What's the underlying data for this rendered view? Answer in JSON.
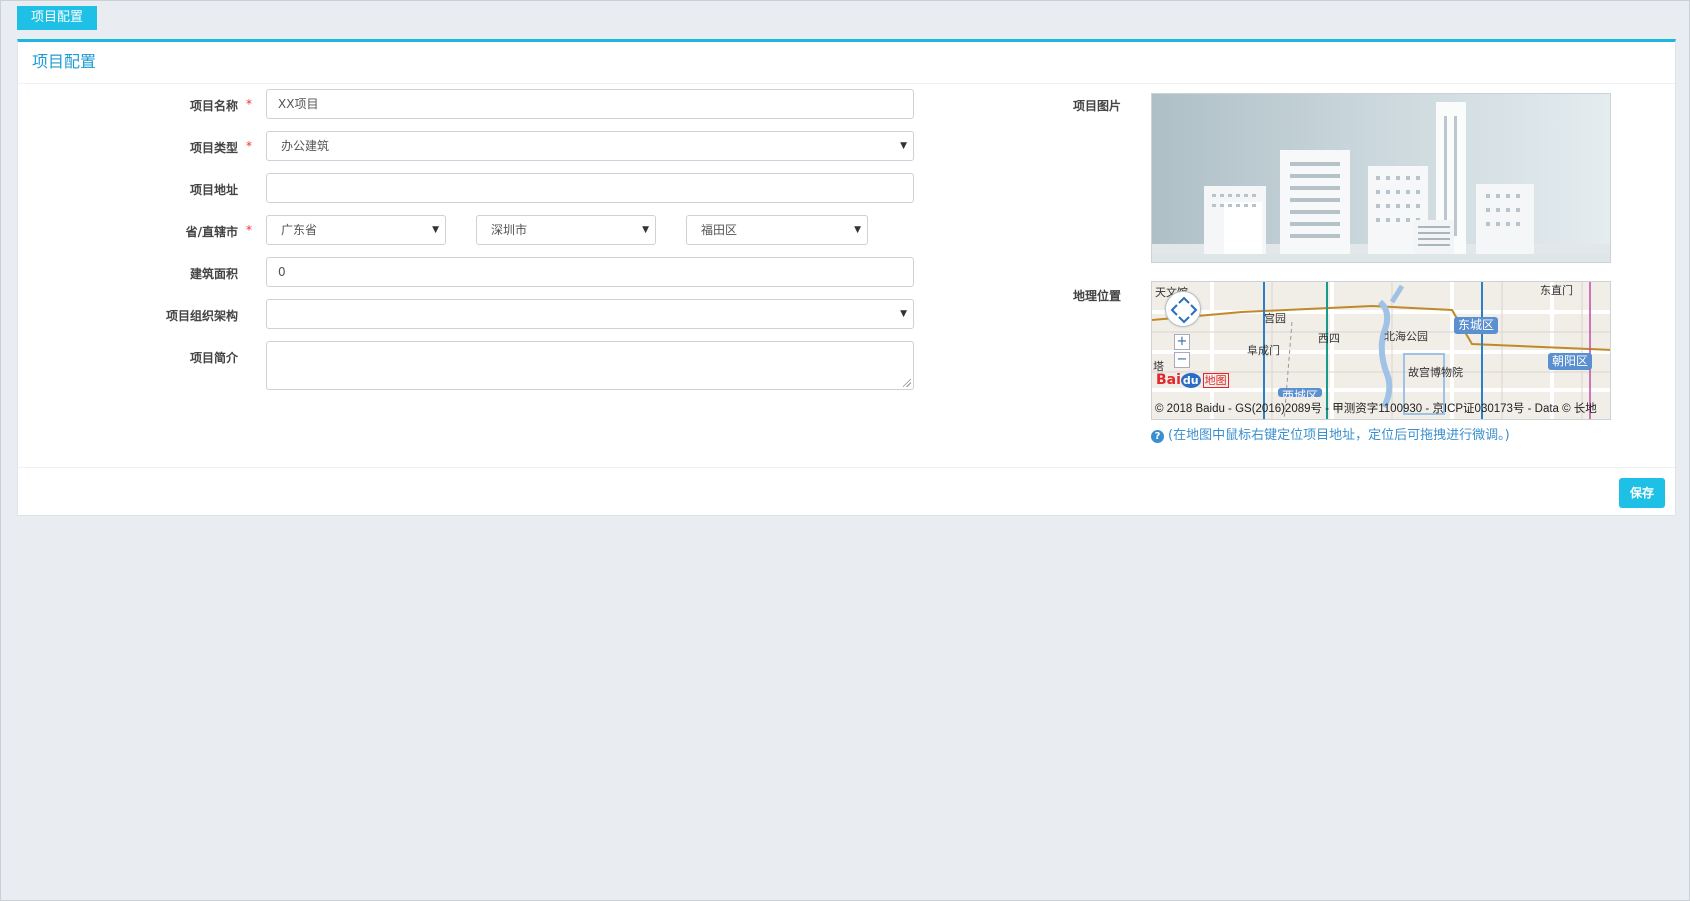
{
  "tab": {
    "label": "项目配置"
  },
  "panel": {
    "title": "项目配置"
  },
  "form": {
    "name": {
      "label": "项目名称",
      "required": "*",
      "value": "XX项目"
    },
    "type": {
      "label": "项目类型",
      "required": "*",
      "value": "办公建筑"
    },
    "address": {
      "label": "项目地址",
      "value": ""
    },
    "region": {
      "label": "省/直辖市",
      "required": "*",
      "province": "广东省",
      "city": "深圳市",
      "district": "福田区"
    },
    "area": {
      "label": "建筑面积",
      "value": "0"
    },
    "org": {
      "label": "项目组织架构",
      "value": ""
    },
    "intro": {
      "label": "项目简介",
      "value": ""
    }
  },
  "side": {
    "image_label": "项目图片",
    "location_label": "地理位置",
    "map": {
      "labels": [
        "天文馆",
        "宫园",
        "西四",
        "阜成门",
        "北海公园",
        "故宫博物院",
        "东直门",
        "塔"
      ],
      "districts": [
        "东城区",
        "朝阳区",
        "西城区"
      ],
      "copyright": "© 2018 Baidu - GS(2016)2089号 - 甲测资字1100930 - 京ICP证030173号 - Data © 长地",
      "logo_text": "Bai",
      "logo_du": "du",
      "logo_map": "地图"
    },
    "hint": "(在地图中鼠标右键定位项目地址，定位后可拖拽进行微调。)"
  },
  "actions": {
    "save": "保存"
  },
  "colors": {
    "accent": "#1ec0e6",
    "link": "#3a8fcf",
    "required": "#e33333"
  },
  "icons": {
    "hint": "question-circle-icon",
    "caret": "triangle-down-icon"
  }
}
